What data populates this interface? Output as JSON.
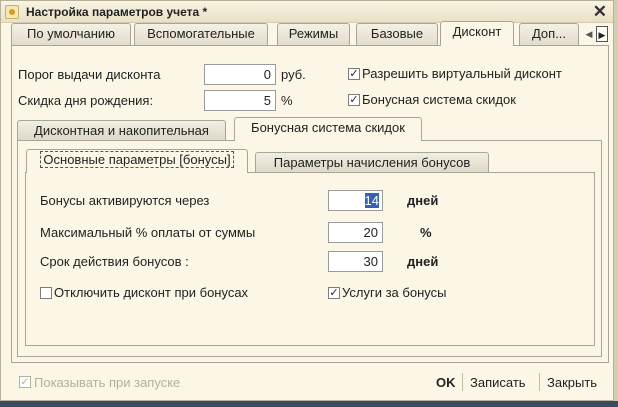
{
  "window": {
    "title": "Настройка параметров учета *"
  },
  "top_tabs": [
    {
      "label": "По умолчанию"
    },
    {
      "label": "Вспомогательные"
    },
    {
      "label": "Режимы"
    },
    {
      "label": "Базовые"
    },
    {
      "label": "Дисконт"
    },
    {
      "label": "Доп..."
    }
  ],
  "active_top_tab": "Дисконт",
  "discount": {
    "threshold_label": "Порог выдачи дисконта",
    "threshold_value": "0",
    "threshold_unit": "руб.",
    "birthday_label": "Скидка дня рождения:",
    "birthday_value": "5",
    "birthday_unit": "%",
    "allow_virtual_label": "Разрешить виртуальный дисконт",
    "allow_virtual_checked": true,
    "bonus_system_label": "Бонусная система скидок",
    "bonus_system_checked": true
  },
  "sub_tabs": [
    {
      "label": "Дисконтная и накопительная"
    },
    {
      "label": "Бонусная система скидок"
    }
  ],
  "inner_tabs": [
    {
      "label": "Основные параметры [бонусы]"
    },
    {
      "label": "Параметры начисления бонусов"
    }
  ],
  "bonus": {
    "activate_label": "Бонусы активируются через",
    "activate_value": "14",
    "activate_unit": "дней",
    "max_pay_label": "Максимальный % оплаты от суммы",
    "max_pay_value": "20",
    "max_pay_unit": "%",
    "validity_label": "Срок действия бонусов :",
    "validity_value": "30",
    "validity_unit": "дней",
    "disable_discount_label": "Отключить дисконт при бонусах",
    "disable_discount_checked": false,
    "services_label": "Услуги за бонусы",
    "services_checked": true
  },
  "footer": {
    "show_on_start_label": "Показывать при запуске",
    "show_on_start_checked": true,
    "ok_label": "OK",
    "save_label": "Записать",
    "close_label": "Закрыть"
  },
  "check_glyph": "✓"
}
